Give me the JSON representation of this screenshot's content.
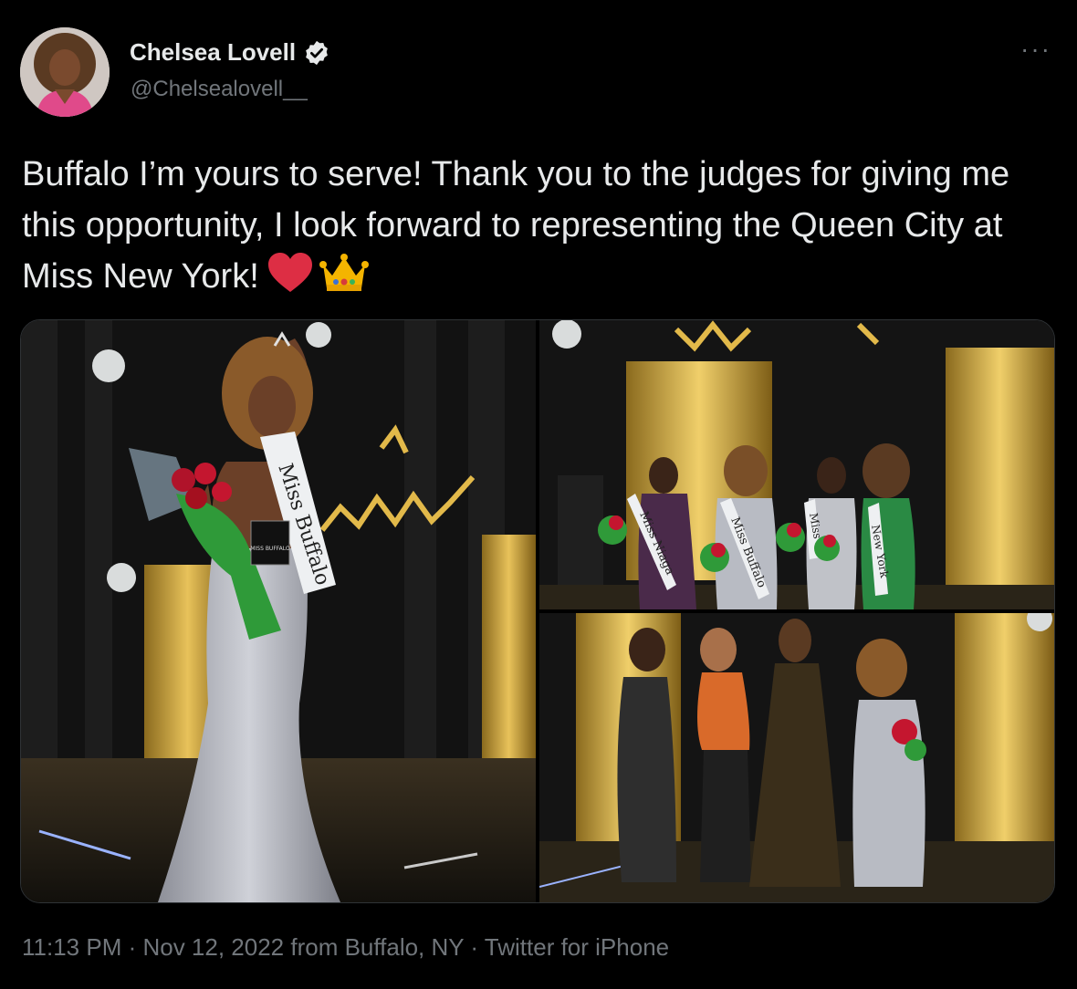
{
  "author": {
    "name": "Chelsea Lovell",
    "handle": "@Chelsealovell__",
    "verified": true,
    "avatar_icon": "profile-photo"
  },
  "more_label": "···",
  "tweet": {
    "text": "Buffalo I’m yours to serve! Thank you to the judges for giving me this opportunity, I look forward to representing the Queen City at Miss New York!",
    "emojis": [
      "red-heart-emoji",
      "crown-emoji"
    ]
  },
  "media": {
    "photos": [
      {
        "sash": "Miss Buffalo",
        "award": "MISS BUFFALO"
      },
      {
        "sashes": [
          "Miss Niaga",
          "Miss Buffalo",
          "Miss",
          "New York"
        ]
      },
      {
        "sashes": []
      }
    ]
  },
  "meta": {
    "time": "11:13 PM",
    "sep1": " · ",
    "date": "Nov 12, 2022 from Buffalo, NY",
    "sep2": " · ",
    "source": "Twitter for iPhone"
  },
  "colors": {
    "background": "#000000",
    "text": "#e7e9ea",
    "secondary": "#71767b",
    "verified_badge": "#e7e9ea"
  }
}
